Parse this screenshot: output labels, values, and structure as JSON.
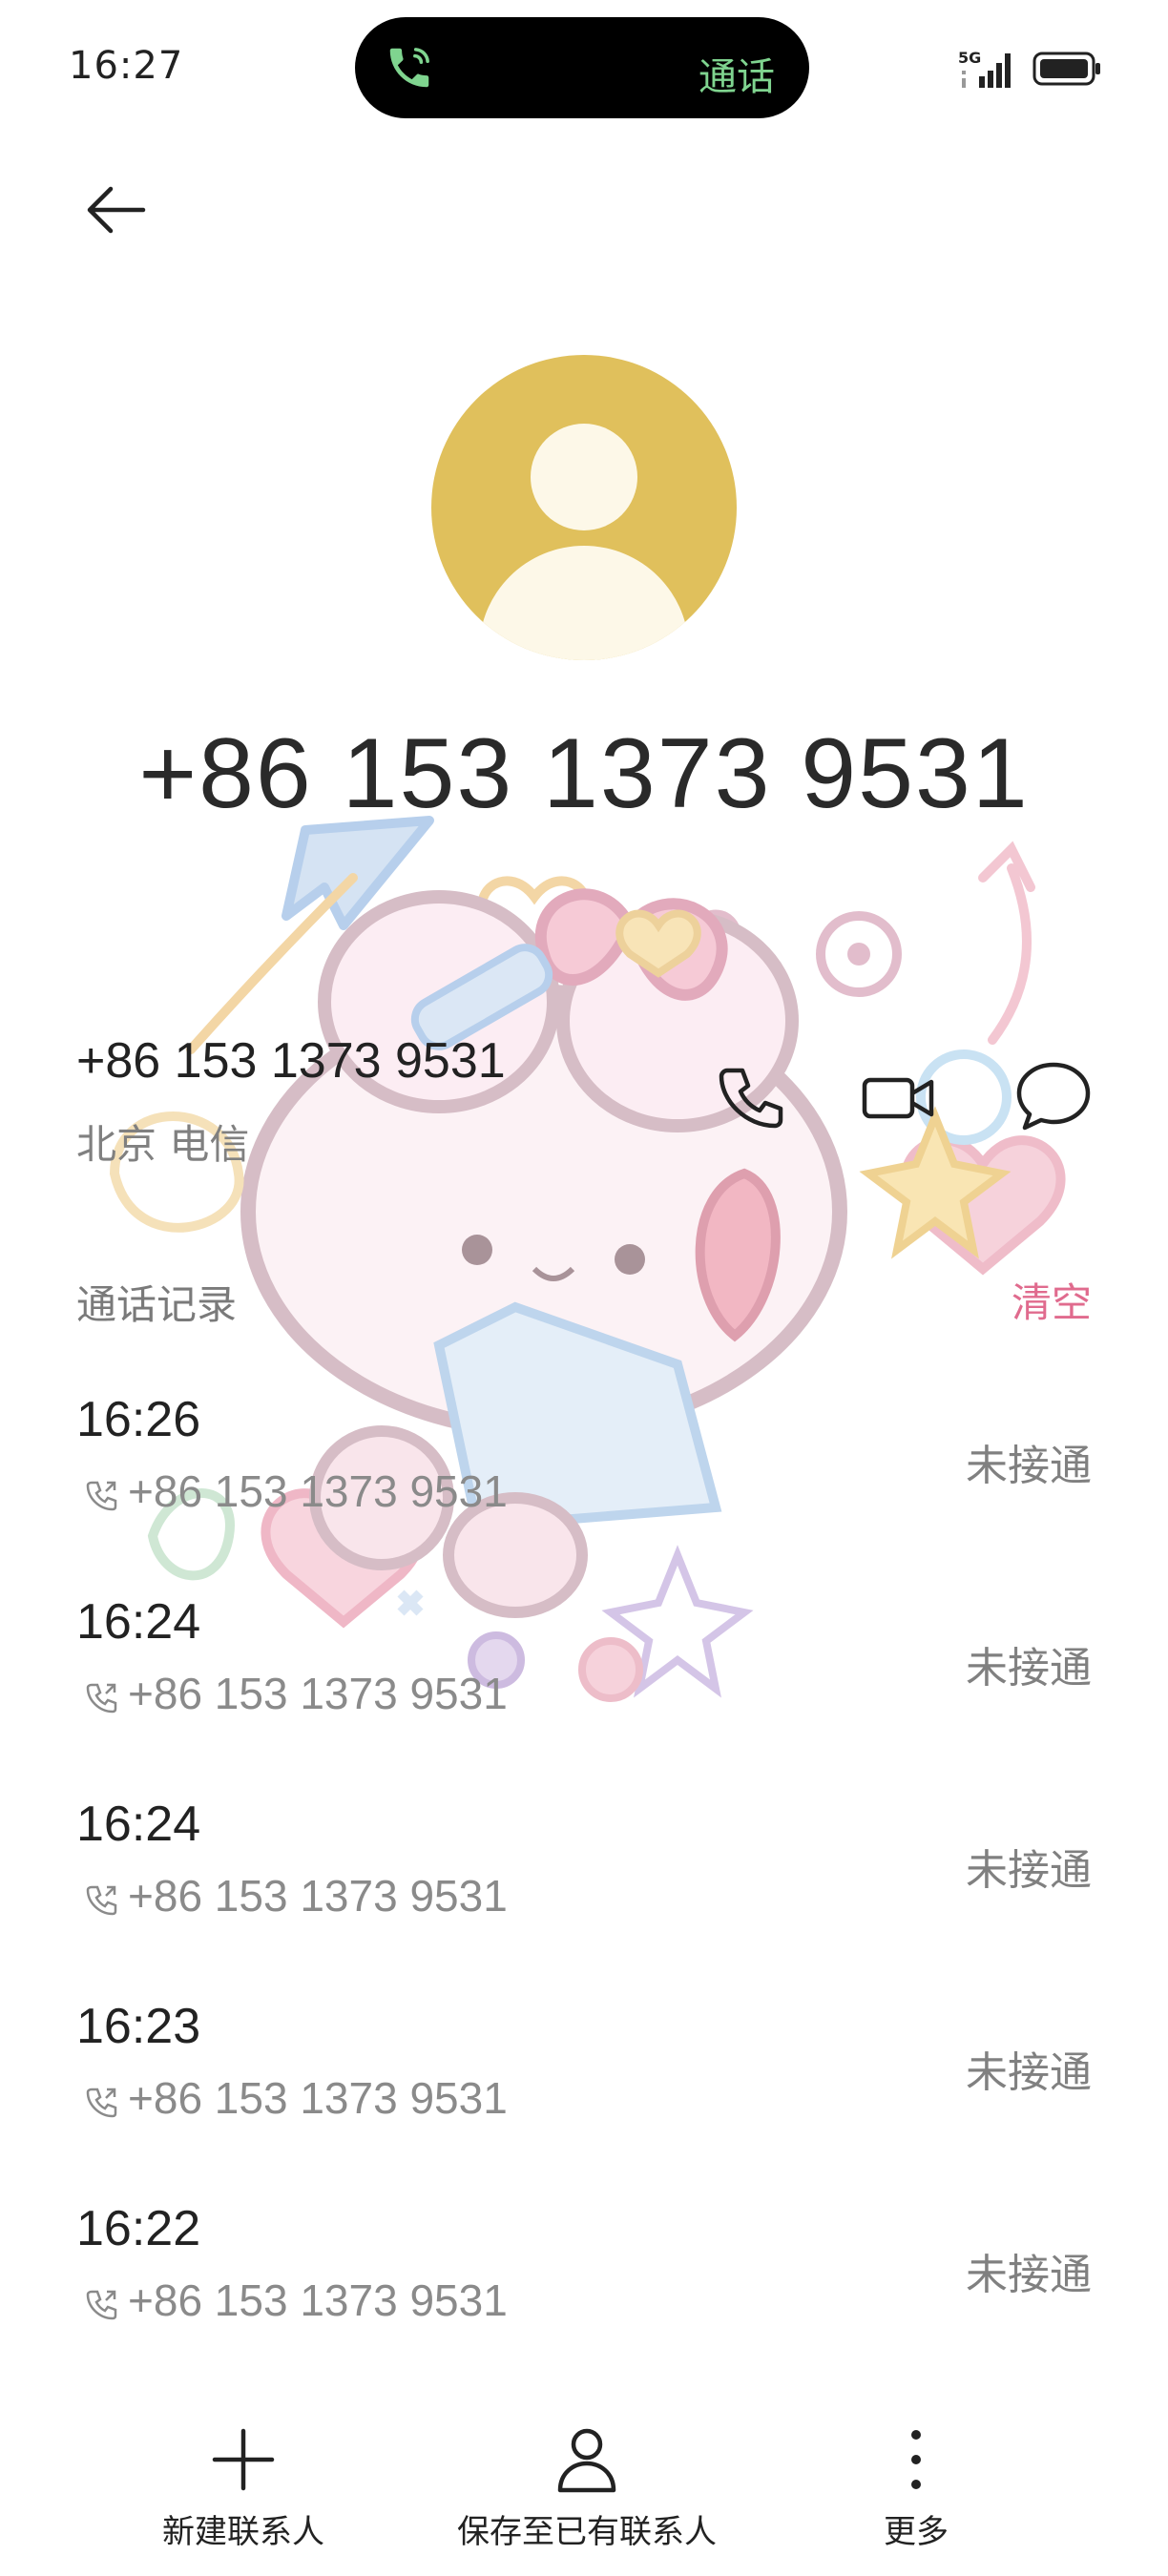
{
  "status_bar": {
    "time": "16:27",
    "call_pill_label": "通话",
    "network": "5G",
    "icons": [
      "phone-active-icon",
      "signal-icon",
      "battery-icon"
    ]
  },
  "header": {
    "back_icon": "arrow-left-icon"
  },
  "contact": {
    "avatar_icon": "person-icon",
    "avatar_color": "#e0c05c",
    "display_number": "+86 153 1373 9531",
    "number": "+86 153 1373 9531",
    "location": "北京 电信",
    "actions": [
      {
        "name": "call",
        "icon": "phone-icon"
      },
      {
        "name": "video",
        "icon": "video-camera-icon"
      },
      {
        "name": "message",
        "icon": "message-bubble-icon"
      }
    ]
  },
  "call_log": {
    "heading": "通话记录",
    "clear_label": "清空",
    "clear_color": "#e06b8e",
    "entries": [
      {
        "time": "16:26",
        "number": "+86 153 1373 9531",
        "status": "未接通"
      },
      {
        "time": "16:24",
        "number": "+86 153 1373 9531",
        "status": "未接通"
      },
      {
        "time": "16:24",
        "number": "+86 153 1373 9531",
        "status": "未接通"
      },
      {
        "time": "16:23",
        "number": "+86 153 1373 9531",
        "status": "未接通"
      },
      {
        "time": "16:22",
        "number": "+86 153 1373 9531",
        "status": "未接通"
      }
    ]
  },
  "bottom_bar": {
    "new_contact": "新建联系人",
    "save_to_existing": "保存至已有联系人",
    "more": "更多"
  }
}
